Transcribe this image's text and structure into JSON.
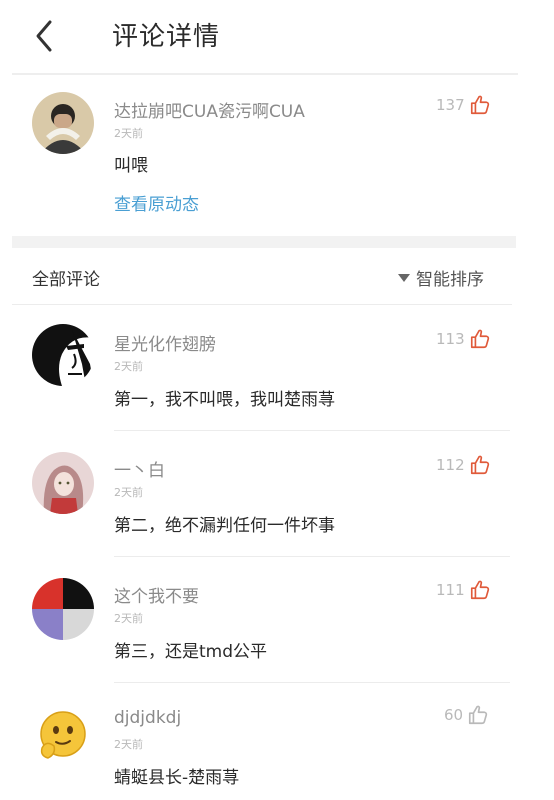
{
  "header": {
    "title": "评论详情"
  },
  "post": {
    "username": "达拉崩吧CUA瓷污啊CUA",
    "time": "2天前",
    "text": "叫喂",
    "likes": "137",
    "view_link": "查看原动态"
  },
  "comments_section": {
    "label": "全部评论",
    "sort_label": "智能排序"
  },
  "comments": [
    {
      "username": "星光化作翅膀",
      "time": "2天前",
      "text": "第一，我不叫喂，我叫楚雨荨",
      "likes": "113"
    },
    {
      "username": "一丶白",
      "time": "2天前",
      "text": "第二，绝不漏判任何一件坏事",
      "likes": "112"
    },
    {
      "username": "这个我不要",
      "time": "2天前",
      "text": "第三，还是tmd公平",
      "likes": "111"
    },
    {
      "username": "djdjdkdj",
      "time": "2天前",
      "text": "蜻蜓县长-楚雨荨",
      "likes": "60"
    }
  ],
  "colors": {
    "accent": "#e05a3a",
    "link": "#4a9fd3"
  }
}
